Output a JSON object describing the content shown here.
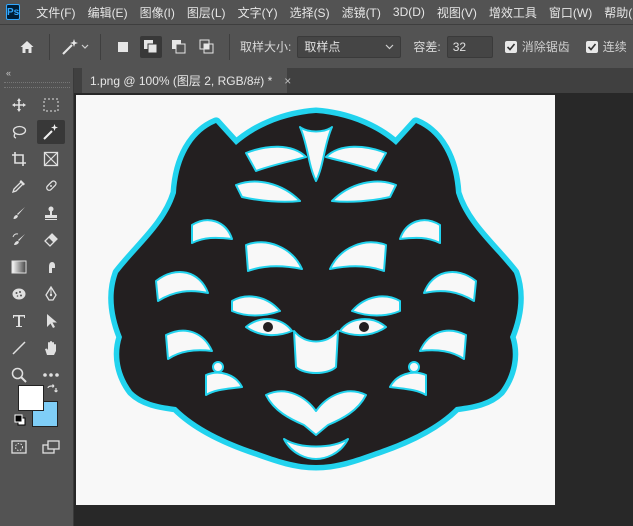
{
  "app": {
    "logo": "Ps",
    "logo_color": "#31a8ff"
  },
  "menu": [
    "文件(F)",
    "编辑(E)",
    "图像(I)",
    "图层(L)",
    "文字(Y)",
    "选择(S)",
    "滤镜(T)",
    "3D(D)",
    "视图(V)",
    "增效工具",
    "窗口(W)",
    "帮助(H)"
  ],
  "options": {
    "sample_size_label": "取样大小:",
    "sample_size_value": "取样点",
    "tolerance_label": "容差:",
    "tolerance_value": "32",
    "antialias_label": "消除锯齿",
    "antialias_checked": true,
    "contiguous_label": "连续",
    "contiguous_checked": true
  },
  "toolbar": {
    "collapse_glyph": "‹‹",
    "active_tool": "magic-wand",
    "foreground_color": "#ffffff",
    "background_color": "#7fcef7"
  },
  "document": {
    "tab_title": "1.png @ 100% (图层 2, RGB/8#) *",
    "close_glyph": "×"
  },
  "colors": {
    "tiger_fill": "#231f20",
    "selection_outline": "#22d3ee",
    "canvas": "#f8f8f8"
  }
}
